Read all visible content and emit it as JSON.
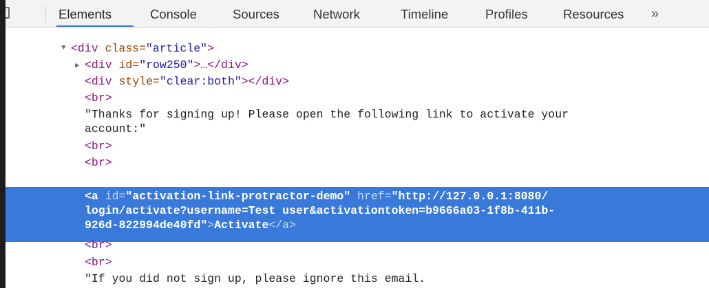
{
  "toolbar": {
    "tabs": [
      {
        "label": "Elements"
      },
      {
        "label": "Console"
      },
      {
        "label": "Sources"
      },
      {
        "label": "Network"
      },
      {
        "label": "Timeline"
      },
      {
        "label": "Profiles"
      },
      {
        "label": "Resources"
      }
    ],
    "more_label": "»",
    "active_tab": "Elements"
  },
  "dom": {
    "article_open": {
      "tag_open": "<div",
      "attr": " class=",
      "val": "\"article\"",
      "tag_close": ">"
    },
    "row250": {
      "tag_open": "<div",
      "attr": " id=",
      "val": "\"row250\"",
      "tag_close": ">…</div>"
    },
    "clear": {
      "tag_open": "<div",
      "attr": " style=",
      "val": "\"clear:both\"",
      "tag_close": "></div>"
    },
    "br": "<br>",
    "thanks_line1": "\"Thanks for signing up! Please open the following link to activate your",
    "thanks_line2": "account:\"",
    "anchor_line1_tag": "<a",
    "anchor_line1_attr1": " id=",
    "anchor_line1_val1": "\"activation-link-protractor-demo\"",
    "anchor_line1_attr2": " href=",
    "anchor_line1_val2": "\"http://127.0.0.1:8080/",
    "anchor_line2": "login/activate?username=Test user&activationtoken=b9666a03-1f8b-411b-",
    "anchor_line3_val": "926d-822994de40fd\"",
    "anchor_line3_close1": ">",
    "anchor_line3_text": "Activate",
    "anchor_line3_close2": "</a>",
    "ignore_line": "\"If you did not sign up, please ignore this email."
  },
  "colors": {
    "selection": "#3879d9",
    "tag": "#881280",
    "attr": "#994500",
    "value": "#1a1aa6"
  }
}
